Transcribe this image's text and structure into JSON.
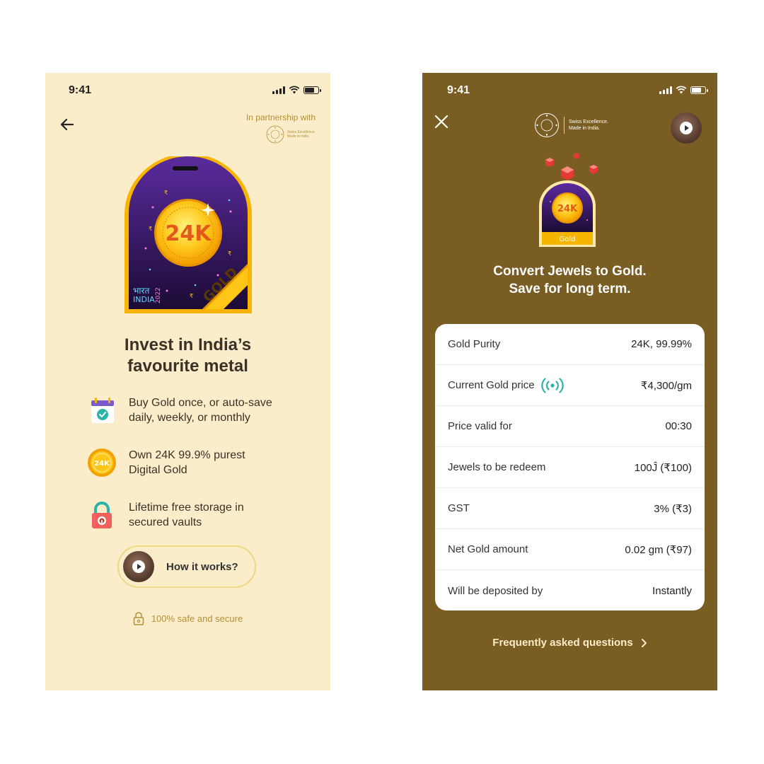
{
  "left": {
    "status": {
      "time": "9:41"
    },
    "partner": {
      "label": "In partnership with",
      "tagline_1": "Swiss Excellence.",
      "tagline_2": "Made in India."
    },
    "badge": {
      "coin_text": "24K",
      "ribbon_text": "GOLD",
      "hindi_text": "भारत",
      "country_text": "INDIA",
      "year_text": "2022"
    },
    "title_line1": "Invest in India’s",
    "title_line2": "favourite metal",
    "features": [
      {
        "icon": "calendar-check-icon",
        "line1": "Buy Gold once, or auto-save",
        "line2": "daily, weekly, or monthly"
      },
      {
        "icon": "gold-coin-icon",
        "line1": "Own 24K 99.9% purest",
        "line2": "Digital Gold",
        "coin_text": "24K"
      },
      {
        "icon": "padlock-icon",
        "line1": "Lifetime free storage in",
        "line2": "secured vaults"
      }
    ],
    "how_button": "How it works?",
    "safe_text": "100% safe and secure"
  },
  "right": {
    "status": {
      "time": "9:41"
    },
    "brand": {
      "tagline_1": "Swiss Excellence.",
      "tagline_2": "Made in India."
    },
    "badge": {
      "coin_text": "24K",
      "label": "Gold"
    },
    "title_line1": "Convert Jewels to Gold.",
    "title_line2": "Save for long term.",
    "rows": [
      {
        "label": "Gold Purity",
        "value": "24K, 99.99%"
      },
      {
        "label": "Current Gold price",
        "value": "₹4,300/gm",
        "live_icon": "live-broadcast-icon"
      },
      {
        "label": "Price valid for",
        "value": "00:30"
      },
      {
        "label": "Jewels to be redeem",
        "value": "100Ĵ (₹100)"
      },
      {
        "label": "GST",
        "value": "3% (₹3)"
      },
      {
        "label": "Net Gold amount",
        "value": "0.02 gm (₹97)"
      },
      {
        "label": "Will be deposited by",
        "value": "Instantly"
      }
    ],
    "faq_link": "Frequently asked questions"
  },
  "colors": {
    "left_bg": "#fbedc9",
    "right_bg": "#7a5d22",
    "gold": "#f5b400",
    "accent_text": "#b38f35",
    "live_teal": "#2ab3a6"
  }
}
